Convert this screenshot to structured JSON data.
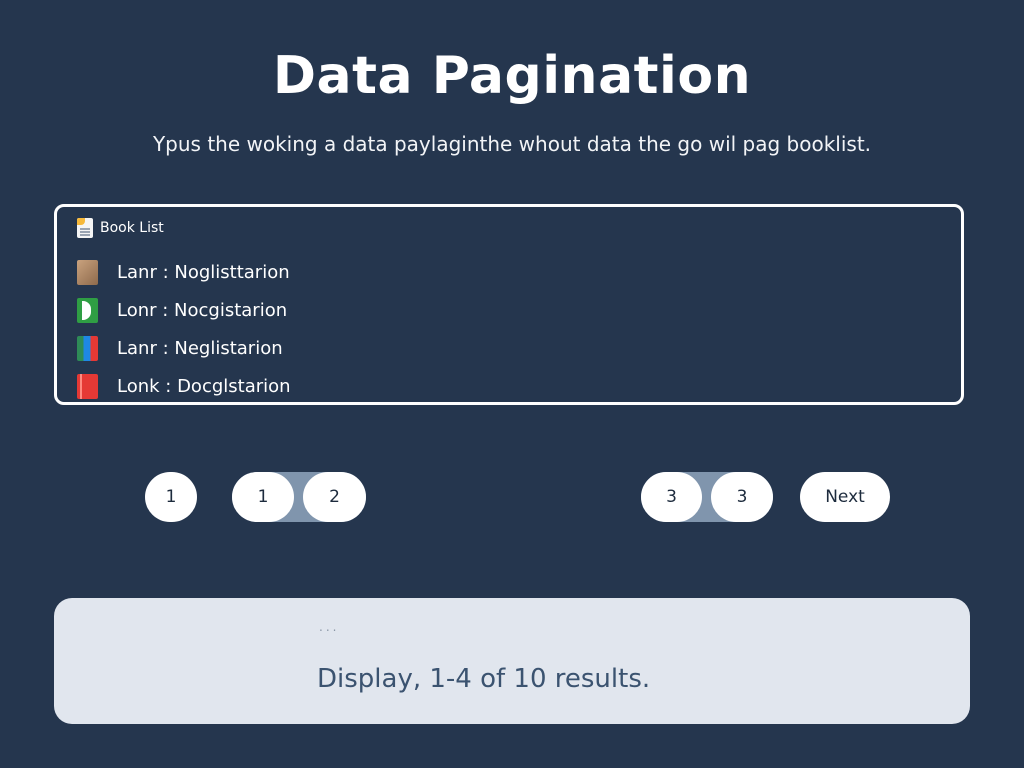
{
  "header": {
    "title": "Data Pagination",
    "subtitle": "Ypus the woking a data paylaginthe whout data the go wil pag booklist."
  },
  "book_panel": {
    "header_icon": "document-icon",
    "header_label": "Book List",
    "items": [
      {
        "label": "Lanr : Noglisttarion",
        "icon": "book-cover-brown-icon"
      },
      {
        "label": "Lonr : Nocgistarion",
        "icon": "book-cover-green-icon"
      },
      {
        "label": "Lanr : Neglistarion",
        "icon": "book-cover-multicolor-icon"
      },
      {
        "label": "Lonk : Docglstarion",
        "icon": "book-cover-red-icon"
      }
    ]
  },
  "pagination": {
    "first": "1",
    "group_left": [
      "1",
      "2"
    ],
    "group_right": [
      "3",
      "3"
    ],
    "next_label": "Next"
  },
  "results": {
    "dots": "...",
    "text": "Display, 1-4 of 10 results."
  },
  "colors": {
    "background": "#25364e",
    "panel_border": "#ffffff",
    "button_bg": "#ffffff",
    "button_track": "#8095ad",
    "results_bg": "#e1e6ee",
    "results_text": "#3b5370"
  }
}
